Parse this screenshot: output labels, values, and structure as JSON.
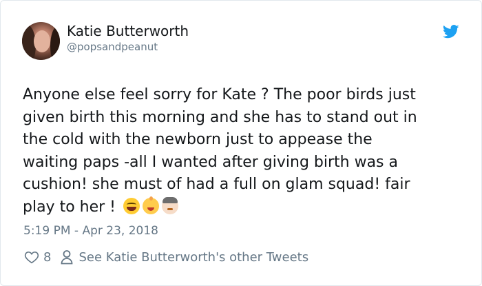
{
  "user": {
    "display_name": "Katie Butterworth",
    "handle": "@popsandpeanut"
  },
  "tweet": {
    "lines": [
      "Anyone else feel sorry for Kate ? The poor birds just",
      "given birth this morning and she has to stand out in",
      "the cold with the newborn just to appease the",
      "waiting paps -all I wanted after giving birth was a",
      "cushion! she must of had a full on glam squad! fair",
      "play to her !"
    ],
    "emojis": [
      "grinning-squinting-face",
      "baby",
      "person-with-white-hair"
    ]
  },
  "timestamp": "5:19 PM - Apr 23, 2018",
  "actions": {
    "like_count": "8",
    "other_tweets_label": "See Katie Butterworth's other Tweets"
  },
  "colors": {
    "twitter_blue": "#1da1f2",
    "text": "#14171a",
    "secondary": "#657786",
    "border": "#e1e8ed"
  },
  "icons": {
    "brand": "twitter-bird-icon",
    "like": "heart-icon",
    "profile": "person-icon"
  }
}
